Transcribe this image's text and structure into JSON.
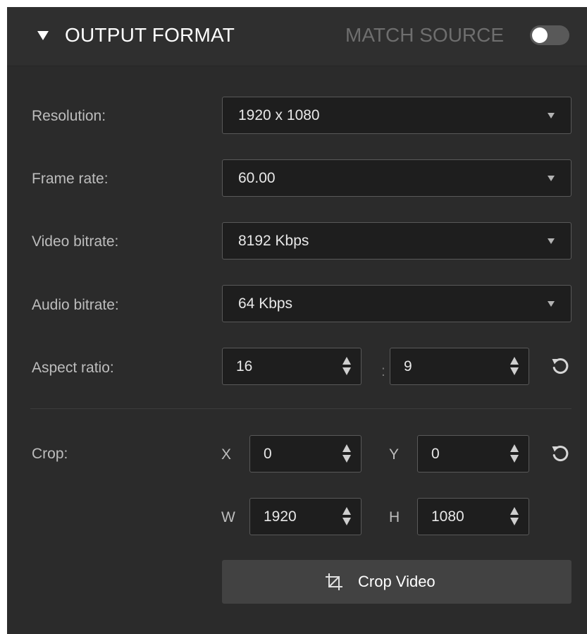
{
  "header": {
    "title": "OUTPUT FORMAT",
    "match_source_label": "MATCH SOURCE",
    "match_source_on": false
  },
  "fields": {
    "resolution": {
      "label": "Resolution:",
      "value": "1920 x 1080"
    },
    "frame_rate": {
      "label": "Frame rate:",
      "value": "60.00"
    },
    "video_bitrate": {
      "label": "Video bitrate:",
      "value": "8192 Kbps"
    },
    "audio_bitrate": {
      "label": "Audio bitrate:",
      "value": "64 Kbps"
    }
  },
  "aspect": {
    "label": "Aspect ratio:",
    "width": "16",
    "separator": ":",
    "height": "9"
  },
  "crop": {
    "label": "Crop:",
    "x_label": "X",
    "x": "0",
    "y_label": "Y",
    "y": "0",
    "w_label": "W",
    "w": "1920",
    "h_label": "H",
    "h": "1080",
    "button_label": "Crop Video"
  },
  "colors": {
    "panel_bg": "#2b2b2b",
    "field_bg": "#1e1e1e",
    "field_border": "#595959",
    "button_bg": "#424242"
  }
}
